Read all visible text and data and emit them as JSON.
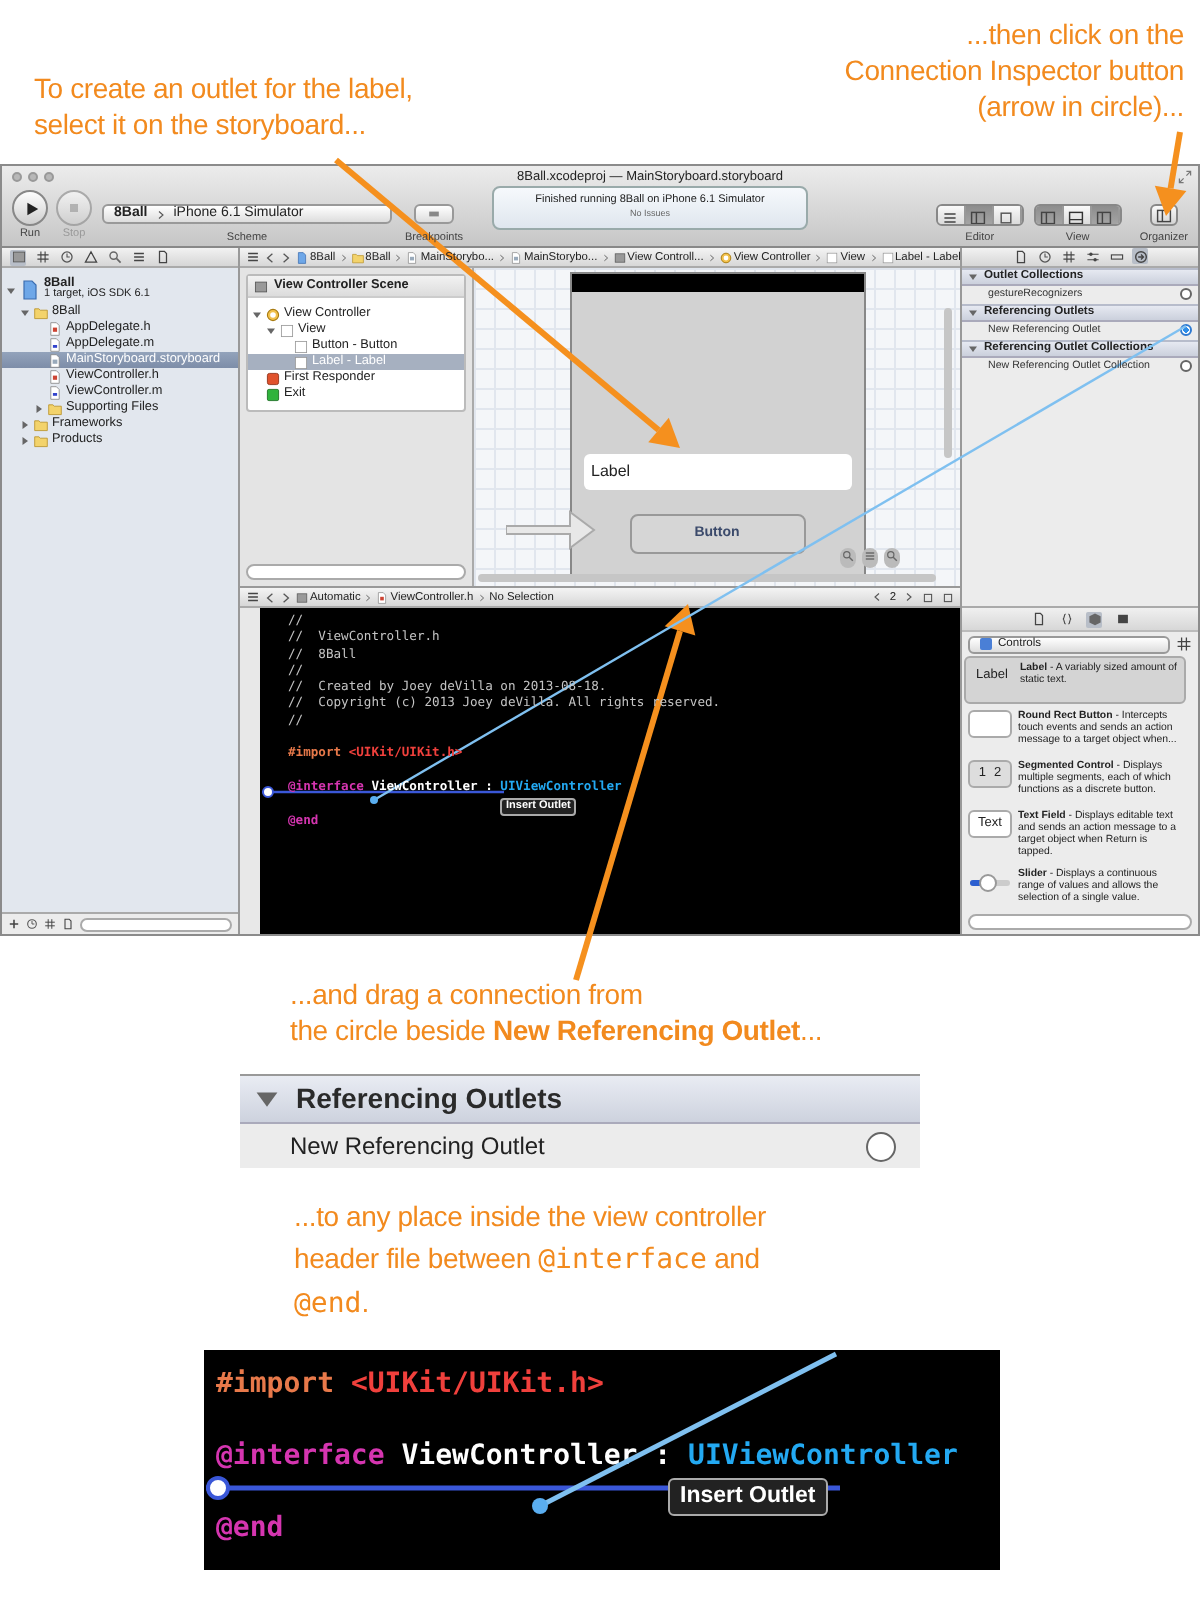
{
  "callouts_top": [
    {
      "lines": [
        [
          {
            "kind": "text",
            "text": "To create an outlet for the label,"
          }
        ],
        [
          {
            "kind": "text",
            "text": "select it on the storyboard..."
          }
        ]
      ]
    },
    {
      "lines": [
        [
          {
            "kind": "text",
            "text": "...then click on the"
          }
        ],
        [
          {
            "kind": "text",
            "text": "Connection Inspector button"
          }
        ],
        [
          {
            "kind": "text",
            "text": "(arrow in circle)..."
          }
        ]
      ]
    }
  ],
  "window": {
    "title": "8Ball.xcodeproj — MainStoryboard.storyboard",
    "toolbar": {
      "run_label": "Run",
      "stop_label": "Stop",
      "scheme": [
        "8Ball",
        "iPhone 6.1 Simulator"
      ],
      "scheme_label": "Scheme",
      "breakpoints_label": "Breakpoints",
      "status": "Finished running 8Ball on iPhone 6.1 Simulator",
      "issues": "No Issues",
      "editor_label": "Editor",
      "view_label": "View",
      "organizer_label": "Organizer",
      "editor_modes": [
        {
          "selected": false
        },
        {
          "selected": true
        },
        {
          "selected": false
        }
      ],
      "view_toggles": [
        {
          "on": true
        },
        {
          "on": false
        },
        {
          "on": true
        }
      ]
    },
    "navigator_tabs": [
      {
        "selected": true
      },
      {
        "selected": false
      },
      {
        "selected": false
      },
      {
        "selected": false
      },
      {
        "selected": false
      },
      {
        "selected": false
      },
      {
        "selected": false
      }
    ],
    "navigator": [
      {
        "name": "8Ball",
        "subtitle": "1 target, iOS SDK 6.1",
        "kind": "project",
        "expanded": true,
        "selected": false,
        "children": [
          {
            "name": "8Ball",
            "kind": "folder",
            "expanded": true,
            "selected": false,
            "children": [
              {
                "name": "AppDelegate.h",
                "kind": "header",
                "selected": false
              },
              {
                "name": "AppDelegate.m",
                "kind": "source",
                "selected": false
              },
              {
                "name": "MainStoryboard.storyboard",
                "kind": "storyboard",
                "selected": true
              },
              {
                "name": "ViewController.h",
                "kind": "header",
                "selected": false
              },
              {
                "name": "ViewController.m",
                "kind": "source",
                "selected": false
              },
              {
                "name": "Supporting Files",
                "kind": "folder",
                "expanded": false,
                "selected": false
              }
            ]
          },
          {
            "name": "Frameworks",
            "kind": "folder",
            "expanded": false,
            "selected": false
          },
          {
            "name": "Products",
            "kind": "folder",
            "expanded": false,
            "selected": false
          }
        ]
      }
    ],
    "jump_bar": [
      {
        "text": "8Ball",
        "kind": "project"
      },
      {
        "text": "8Ball",
        "kind": "folder"
      },
      {
        "text": "MainStorybo...",
        "kind": "storyboard"
      },
      {
        "text": "MainStorybo...",
        "kind": "storyboard"
      },
      {
        "text": "View Controll...",
        "kind": "scene"
      },
      {
        "text": "View Controller",
        "kind": "controller"
      },
      {
        "text": "View",
        "kind": "view"
      },
      {
        "text": "Label - Label",
        "kind": "view"
      }
    ],
    "outline": {
      "title": "View Controller Scene",
      "items": [
        {
          "name": "View Controller",
          "kind": "controller",
          "expanded": true,
          "selected": false,
          "children": [
            {
              "name": "View",
              "kind": "view",
              "expanded": true,
              "selected": false,
              "children": [
                {
                  "name": "Button - Button",
                  "kind": "view",
                  "selected": false
                },
                {
                  "name": "Label - Label",
                  "kind": "view",
                  "selected": true
                }
              ]
            }
          ]
        },
        {
          "name": "First Responder",
          "kind": "responder",
          "selected": false
        },
        {
          "name": "Exit",
          "kind": "exit",
          "selected": false
        }
      ]
    },
    "canvas": {
      "label": "Label",
      "button": "Button"
    },
    "inspector_tabs": [
      {
        "selected": false
      },
      {
        "selected": false
      },
      {
        "selected": false
      },
      {
        "selected": false
      },
      {
        "selected": false
      },
      {
        "selected": true
      }
    ],
    "connections": [
      {
        "title": "Outlet Collections",
        "rows": [
          {
            "name": "gestureRecognizers",
            "connected": false
          }
        ]
      },
      {
        "title": "Referencing Outlets",
        "rows": [
          {
            "name": "New Referencing Outlet",
            "connected": true
          }
        ]
      },
      {
        "title": "Referencing Outlet Collections",
        "rows": [
          {
            "name": "New Referencing Outlet Collection",
            "connected": false
          }
        ]
      }
    ],
    "assistant": {
      "jump_bar": [
        "Automatic",
        "ViewController.h",
        "No Selection"
      ],
      "counter": "2",
      "tooltip": "Insert Outlet",
      "lines": [
        {
          "gap_before": false,
          "tokens": [
            {
              "kind": "comment",
              "text": "//"
            }
          ]
        },
        {
          "gap_before": false,
          "tokens": [
            {
              "kind": "comment",
              "text": "//  ViewController.h"
            }
          ]
        },
        {
          "gap_before": false,
          "tokens": [
            {
              "kind": "comment",
              "text": "//  8Ball"
            }
          ]
        },
        {
          "gap_before": false,
          "tokens": [
            {
              "kind": "comment",
              "text": "//"
            }
          ]
        },
        {
          "gap_before": false,
          "tokens": [
            {
              "kind": "comment",
              "text": "//  Created by Joey deVilla on 2013-08-18."
            }
          ]
        },
        {
          "gap_before": false,
          "tokens": [
            {
              "kind": "comment",
              "text": "//  Copyright (c) 2013 Joey deVilla. All rights reserved."
            }
          ]
        },
        {
          "gap_before": false,
          "tokens": [
            {
              "kind": "comment",
              "text": "//"
            }
          ]
        },
        {
          "gap_before": true,
          "tokens": [
            {
              "kind": "directive",
              "text": "#import "
            },
            {
              "kind": "string",
              "text": "<UIKit/UIKit.h>"
            }
          ]
        },
        {
          "gap_before": true,
          "tokens": [
            {
              "kind": "keyword",
              "text": "@interface"
            },
            {
              "kind": "plain",
              "text": " ViewController : "
            },
            {
              "kind": "type",
              "text": "UIViewController"
            }
          ]
        },
        {
          "gap_before": true,
          "tokens": [
            {
              "kind": "keyword",
              "text": "@end"
            }
          ]
        }
      ]
    },
    "library_tabs": [
      {
        "selected": false
      },
      {
        "selected": false
      },
      {
        "selected": true
      },
      {
        "selected": false
      }
    ],
    "library": {
      "category": "Controls",
      "items": [
        {
          "kind": "label",
          "thumb": "Label",
          "title": "Label",
          "description": "- A variably sized amount of static text.",
          "selected": true
        },
        {
          "kind": "button",
          "title": "Round Rect Button",
          "description": "- Intercepts touch events and sends an action message to a target object when...",
          "selected": false
        },
        {
          "kind": "segmented",
          "segments": [
            "1",
            "2"
          ],
          "title": "Segmented Control",
          "description": "- Displays multiple segments, each of which functions as a discrete button.",
          "selected": false
        },
        {
          "kind": "field",
          "thumb": "Text",
          "title": "Text Field",
          "description": "- Displays editable text and sends an action message to a target object when Return is tapped.",
          "selected": false
        },
        {
          "kind": "slider",
          "title": "Slider",
          "description": "- Displays a continuous range of values and allows the selection of a single value.",
          "selected": false
        }
      ]
    }
  },
  "callout_drag": {
    "lines": [
      [
        {
          "kind": "text",
          "text": "...and drag a connection from"
        }
      ],
      [
        {
          "kind": "text",
          "text": "the circle beside **New Referencing Outlet**..."
        }
      ]
    ]
  },
  "zoom_panel": {
    "header": "Referencing Outlets",
    "row": "New Referencing Outlet",
    "connected": false
  },
  "callout_drop": {
    "lines": [
      [
        {
          "kind": "text",
          "text": "...to any place inside the view controller"
        }
      ],
      [
        {
          "kind": "text",
          "text": "header file between "
        },
        {
          "kind": "code",
          "text": "@interface"
        },
        {
          "kind": "text",
          "text": " and"
        }
      ],
      [
        {
          "kind": "code",
          "text": "@end"
        },
        {
          "kind": "text",
          "text": "."
        }
      ]
    ]
  },
  "code_zoom": {
    "tooltip": "Insert Outlet",
    "lines": [
      {
        "gap_before": false,
        "tokens": [
          {
            "kind": "directive",
            "text": "#import "
          },
          {
            "kind": "string",
            "text": "<UIKit/UIKit.h>"
          }
        ]
      },
      {
        "gap_before": true,
        "tokens": [
          {
            "kind": "keyword",
            "text": "@interface"
          },
          {
            "kind": "plain",
            "text": " ViewController : "
          },
          {
            "kind": "type",
            "text": "UIViewController"
          }
        ]
      },
      {
        "gap_before": true,
        "tokens": [
          {
            "kind": "keyword",
            "text": "@end"
          }
        ]
      }
    ]
  }
}
